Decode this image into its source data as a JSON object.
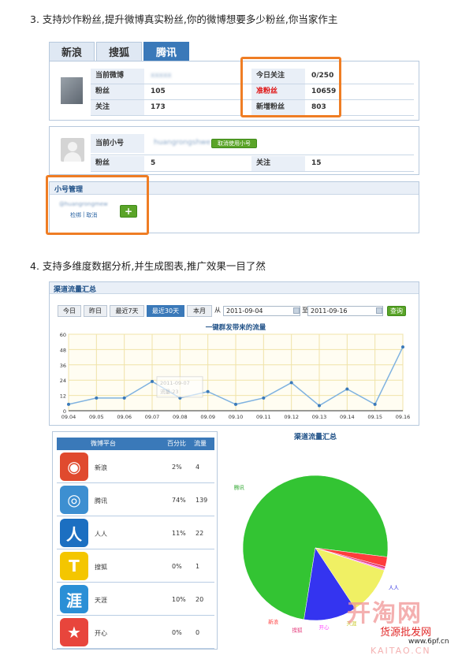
{
  "section3": {
    "heading": "3.  支持炒作粉丝,提升微博真实粉丝,你的微博想要多少粉丝,你当家作主",
    "tabs": [
      "新浪",
      "搜狐",
      "腾讯"
    ],
    "active_tab": 2,
    "account": {
      "current_weibo_label": "当前微博",
      "current_weibo_value": "xxxxx",
      "fans_label": "粉丝",
      "fans_value": "105",
      "follow_label": "关注",
      "follow_value": "173",
      "today_follow_label": "今日关注",
      "today_follow_value": "0/250",
      "quasi_fans_label": "准粉丝",
      "quasi_fans_value": "10659",
      "new_fans_label": "新增粉丝",
      "new_fans_value": "803"
    },
    "sub_account": {
      "current_label": "当前小号",
      "current_value": "huangrongshwe",
      "cancel_button": "取消使用小号",
      "fans_label": "粉丝",
      "fans_value": "5",
      "follow_label": "关注",
      "follow_value": "15"
    },
    "manage": {
      "title": "小号管理",
      "account_name": "@huangrongmew",
      "check": "检绑",
      "separator": "|",
      "cancel": "取消",
      "add": "+"
    }
  },
  "section4": {
    "heading": "4.  支持多维度数据分析,并生成图表,推广效果一目了然",
    "panel_title": "渠道流量汇总",
    "range_buttons": [
      "今日",
      "昨日",
      "最近7天",
      "最近30天",
      "本月"
    ],
    "active_range": 3,
    "from_label": "从",
    "from_date": "2011-09-04",
    "to_label": "至",
    "to_date": "2011-09-16",
    "query_button": "查询",
    "table": {
      "headers": [
        "微博平台",
        "百分比",
        "流量"
      ],
      "rows": [
        {
          "icon": "sina-weibo-icon",
          "name": "新浪",
          "percent": "2%",
          "traffic": "4",
          "color": "#e04a2e"
        },
        {
          "icon": "tencent-weibo-icon",
          "name": "腾讯",
          "percent": "74%",
          "traffic": "139",
          "color": "#3d8fd1"
        },
        {
          "icon": "renren-icon",
          "name": "人人",
          "percent": "11%",
          "traffic": "22",
          "color": "#1c6fc1"
        },
        {
          "icon": "sohu-icon",
          "name": "搜狐",
          "percent": "0%",
          "traffic": "1",
          "color": "#f4c600"
        },
        {
          "icon": "tianya-icon",
          "name": "天涯",
          "percent": "10%",
          "traffic": "20",
          "color": "#2a8fd6"
        },
        {
          "icon": "kaixin-icon",
          "name": "开心",
          "percent": "0%",
          "traffic": "0",
          "color": "#e8453c"
        }
      ]
    },
    "watermark": {
      "brand": "开淘网",
      "slogan": "货源批发网",
      "site": "www.6pf.cn",
      "url": "KAITAO.CN"
    }
  },
  "chart_data": [
    {
      "type": "line",
      "title": "一键群发带来的流量",
      "x": [
        "09.04",
        "09.05",
        "09.06",
        "09.07",
        "09.08",
        "09.09",
        "09.10",
        "09.11",
        "09.12",
        "09.13",
        "09.14",
        "09.15",
        "09.16"
      ],
      "series": [
        {
          "values": [
            5,
            10,
            10,
            23,
            10,
            15,
            5,
            10,
            22,
            4,
            17,
            5,
            50
          ]
        }
      ],
      "yticks": [
        0,
        12,
        24,
        36,
        48,
        60
      ],
      "ylim": [
        0,
        60
      ],
      "grid": true,
      "line_color": "#7fb2e0",
      "tooltip": {
        "line1": "2011-09-07",
        "line2": "流量:23"
      }
    },
    {
      "type": "pie",
      "title": "渠道流量汇总",
      "categories": [
        "腾讯",
        "人人",
        "天涯",
        "开心",
        "搜狐",
        "新浪"
      ],
      "values": [
        139,
        22,
        20,
        0.6,
        1,
        4
      ],
      "colors": [
        "#33c433",
        "#3434f0",
        "#f0f064",
        "#ff77ff",
        "#e43c7c",
        "#ff3c3c"
      ],
      "label_colors": [
        "#2aa52a",
        "#2a2ae0",
        "#c8c828",
        "#ff4aff",
        "#e43c7c",
        "#ff3c3c"
      ]
    }
  ]
}
